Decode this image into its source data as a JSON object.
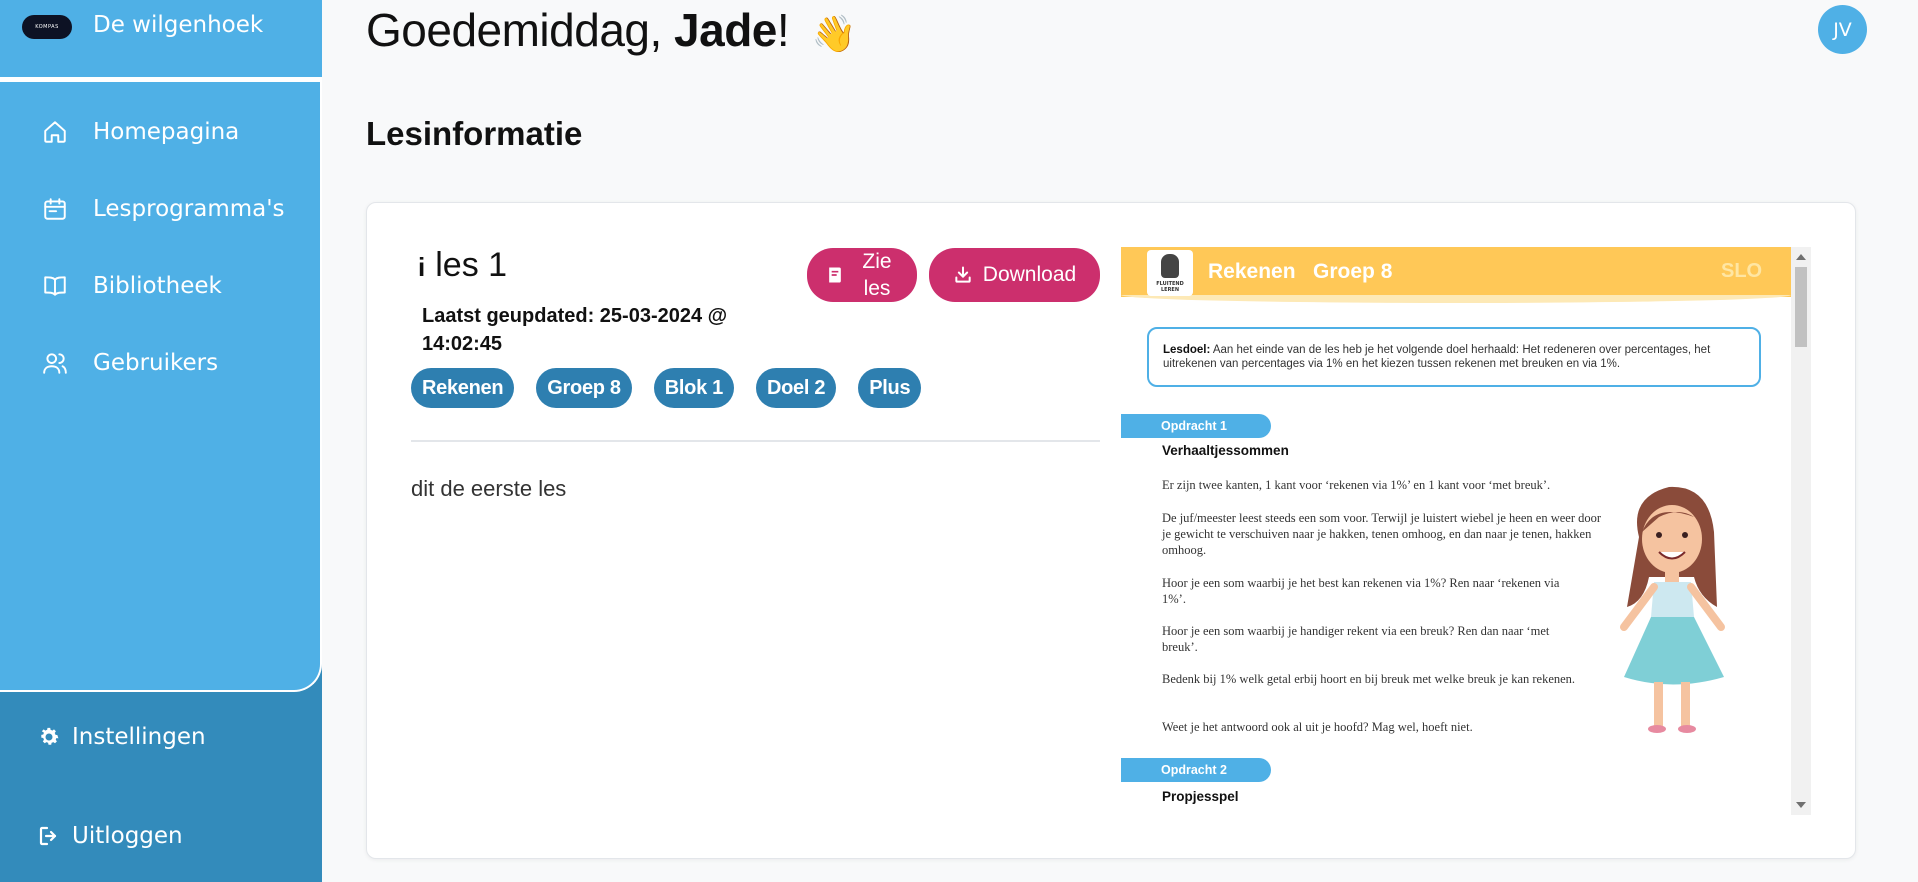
{
  "sidebar": {
    "brand_logo_text": "KOMPAS",
    "brand_name": "De wilgenhoek",
    "items": [
      {
        "label": "Homepagina",
        "icon": "home-icon"
      },
      {
        "label": "Lesprogramma's",
        "icon": "calendar-icon"
      },
      {
        "label": "Bibliotheek",
        "icon": "book-icon"
      },
      {
        "label": "Gebruikers",
        "icon": "users-icon"
      }
    ],
    "settings_label": "Instellingen",
    "logout_label": "Uitloggen"
  },
  "header": {
    "greeting_prefix": "Goedemiddag, ",
    "user_name": "Jade",
    "greeting_suffix": "!",
    "wave_emoji": "👋",
    "avatar_initials": "JV"
  },
  "page": {
    "section_title": "Lesinformatie"
  },
  "lesson": {
    "info_glyph": "i",
    "title": "les 1",
    "updated_line1": "Laatst geupdated: 25-03-2024 @",
    "updated_line2": "14:02:45",
    "view_button": "Zie les",
    "download_button": "Download",
    "tags": [
      "Rekenen",
      "Groep 8",
      "Blok 1",
      "Doel 2",
      "Plus"
    ],
    "description": "dit de eerste les"
  },
  "preview": {
    "logo_text": "FLUITEND LEREN",
    "header_title": "Rekenen   Groep 8",
    "header_badge": "SLO",
    "goal_label": "Lesdoel:",
    "goal_text": " Aan het einde van de les heb je het volgende doel herhaald: Het redeneren over percentages, het uitrekenen van percentages via 1% en het kiezen tussen rekenen met breuken en via 1%.",
    "assignment1_label": "Opdracht 1",
    "assignment1_title": "Verhaaltjessommen",
    "paragraphs": [
      "Er zijn twee kanten, 1 kant voor ‘rekenen via 1%’ en 1 kant voor ‘met breuk’.",
      "De juf/meester leest steeds een som voor. Terwijl je luistert wiebel je heen en weer door je gewicht te verschuiven naar je hakken, tenen omhoog, en dan naar je tenen, hakken omhoog.",
      "Hoor je een som waarbij je het best kan rekenen via 1%? Ren naar ‘rekenen via 1%’.",
      "Hoor je een som waarbij je handiger rekent via een breuk? Ren dan naar ‘met breuk’.",
      "Bedenk bij 1% welk getal erbij hoort en bij breuk met welke breuk je kan rekenen.",
      "Weet je het antwoord ook al uit je hoofd? Mag wel, hoeft niet."
    ],
    "assignment2_label": "Opdracht 2",
    "assignment2_title": "Propjesspel"
  },
  "colors": {
    "sidebar_light": "#4fb0e6",
    "sidebar_dark": "#338bbb",
    "button_pink": "#cc2f6d",
    "tag_blue": "#2e7fb0",
    "preview_yellow": "#ffc857"
  }
}
